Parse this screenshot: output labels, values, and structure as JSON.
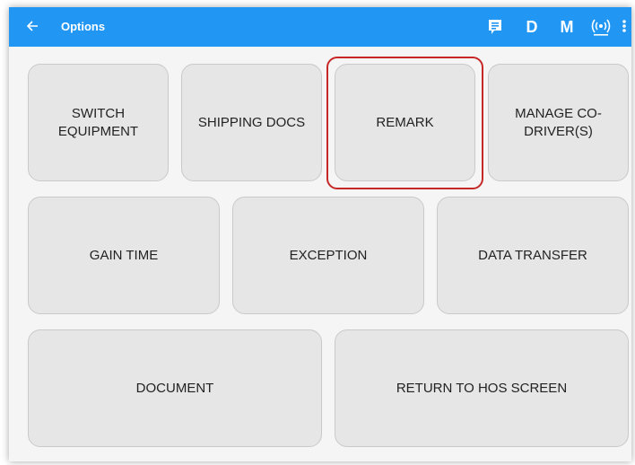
{
  "appbar": {
    "back_icon": "arrow-left-icon",
    "title": "Options",
    "color": "#2196f3",
    "actions": [
      {
        "name": "message-icon"
      },
      {
        "label": "D"
      },
      {
        "label": "M"
      },
      {
        "name": "connection-icon"
      },
      {
        "name": "more-vert-icon"
      }
    ]
  },
  "buttons": {
    "switch_equipment": "SWITCH\nEQUIPMENT",
    "shipping_docs": "SHIPPING DOCS",
    "remark": "REMARK",
    "manage_co_drivers": "MANAGE CO-\nDRIVER(S)",
    "gain_time": "GAIN TIME",
    "exception": "EXCEPTION",
    "data_transfer": "DATA TRANSFER",
    "document": "DOCUMENT",
    "return_to_hos": "RETURN TO HOS SCREEN"
  },
  "highlight_color": "#c62828"
}
